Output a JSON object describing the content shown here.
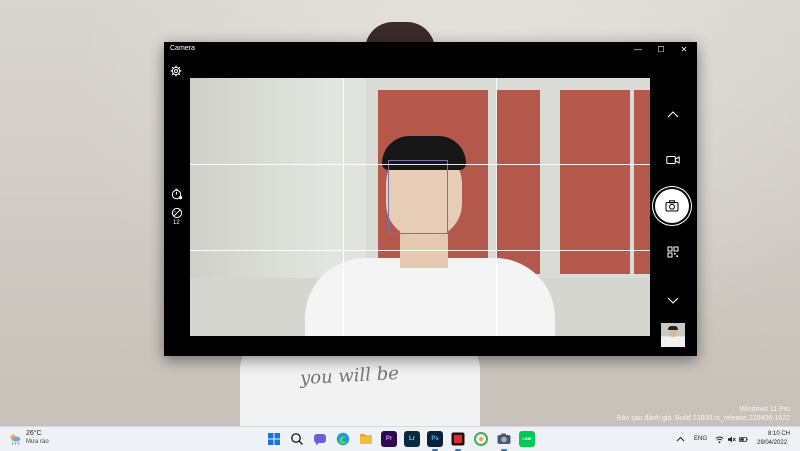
{
  "window": {
    "title": "Camera",
    "minimize_glyph": "—",
    "maximize_glyph": "☐",
    "close_glyph": "✕"
  },
  "camera": {
    "exposure_value": "12",
    "left_icons": [
      "settings-icon",
      "timer-icon",
      "exposure-icon"
    ],
    "right_icons": [
      "chevron-up-icon",
      "video-mode-icon",
      "camera-shutter-icon",
      "qr-scan-icon",
      "chevron-down-icon"
    ],
    "grid": "rule-of-thirds"
  },
  "wallpaper": {
    "shirt_text": "you will be",
    "watermark_line1": "Windows 11 Pro",
    "watermark_line2": "Bản sao đánh giá. Build 22000.rs_release.220406-1622"
  },
  "taskbar": {
    "weather": {
      "temp": "26°C",
      "desc": "Mưa rào"
    },
    "apps": [
      {
        "name": "start",
        "label": ""
      },
      {
        "name": "search",
        "label": ""
      },
      {
        "name": "chat",
        "label": ""
      },
      {
        "name": "edge",
        "label": ""
      },
      {
        "name": "file-explorer",
        "label": ""
      },
      {
        "name": "premiere",
        "label": "Pr"
      },
      {
        "name": "lightroom",
        "label": "Lr"
      },
      {
        "name": "photoshop",
        "label": "Ps"
      },
      {
        "name": "app-red",
        "label": ""
      },
      {
        "name": "app-green",
        "label": ""
      },
      {
        "name": "camera",
        "label": ""
      },
      {
        "name": "line",
        "label": "LINE"
      }
    ],
    "tray": {
      "language": "ENG",
      "time": "8:10 CH",
      "date": "29/04/2022"
    }
  },
  "colors": {
    "window_bg": "#000000",
    "taskbar_bg": "#eef1f5",
    "accent": "#2b7bd3"
  }
}
